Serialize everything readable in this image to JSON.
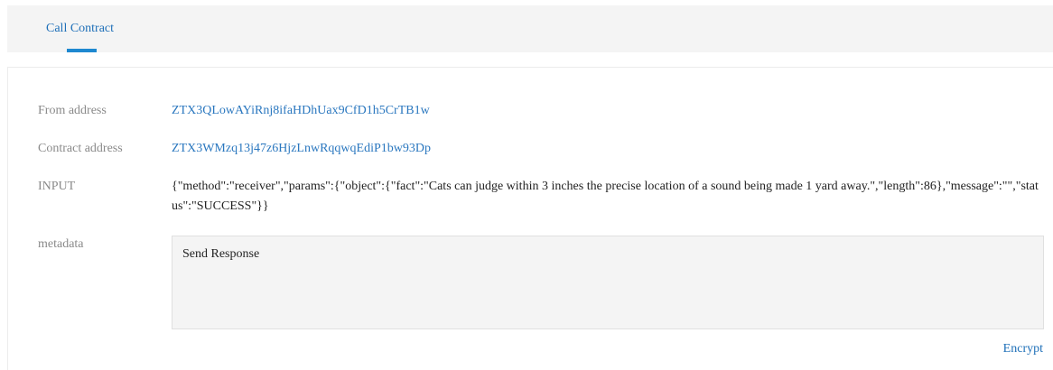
{
  "tabs": {
    "active_label": "Call Contract"
  },
  "fields": {
    "from_label": "From address",
    "from_value": "ZTX3QLowAYiRnj8ifaHDhUax9CfD1h5CrTB1w",
    "contract_label": "Contract address",
    "contract_value": "ZTX3WMzq13j47z6HjzLnwRqqwqEdiP1bw93Dp",
    "input_label": "INPUT",
    "input_value": "{\"method\":\"receiver\",\"params\":{\"object\":{\"fact\":\"Cats can judge within 3 inches the precise location of a sound being made 1 yard away.\",\"length\":86},\"message\":\"\",\"status\":\"SUCCESS\"}}",
    "metadata_label": "metadata",
    "metadata_value": "Send Response"
  },
  "actions": {
    "encrypt_label": "Encrypt"
  },
  "colors": {
    "accent": "#1e88d0",
    "link": "#2a77bf",
    "label": "#8a8a8a"
  }
}
